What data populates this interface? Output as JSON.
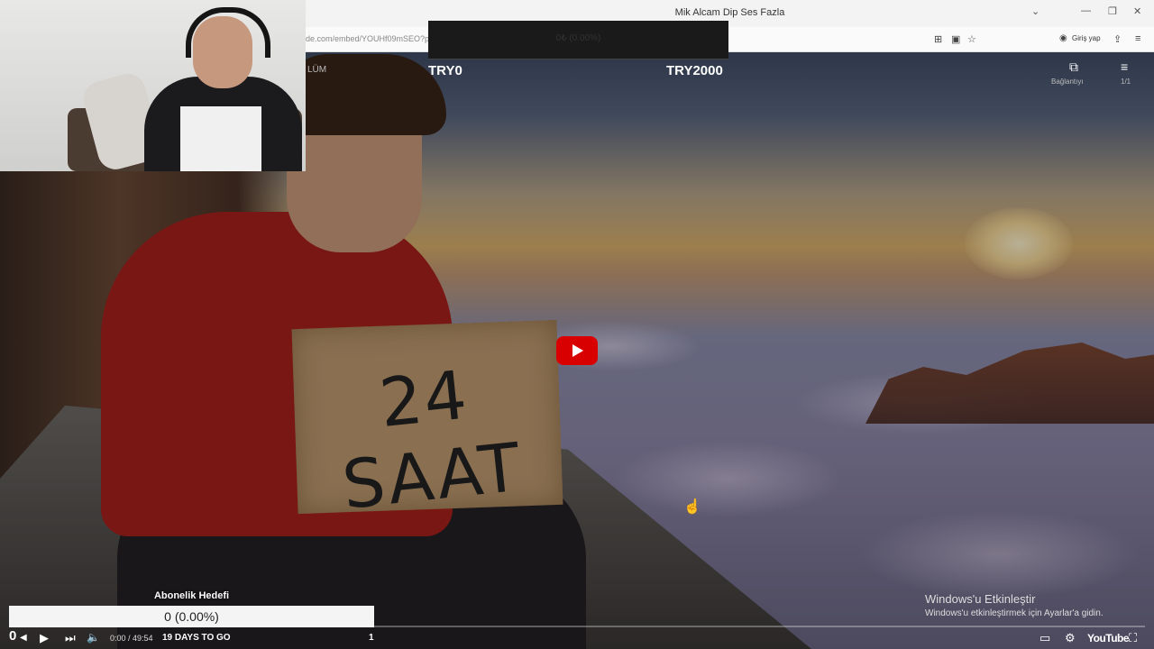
{
  "browser": {
    "window_title": "Mik Alcam Dip Ses Fazla",
    "url": "de.com/embed/YOUHf09mSEO?p",
    "login_label": "Giriş yap",
    "controls": {
      "minimize": "—",
      "maximize": "❐",
      "close": "✕",
      "dropdown": "⌄"
    }
  },
  "overlay": {
    "goal_value_top": "0₺ (0.00%)",
    "range_min": "TRY0",
    "range_max": "TRY2000",
    "chapter_text": "LÜM",
    "sub_goal_title": "Abonelik Hedefi",
    "sub_goal_value": "0 (0.00%)",
    "sub_goal_progress": 0
  },
  "top_right": {
    "copy_label": "Bağlantıyı",
    "playlist_label": "1/1"
  },
  "video": {
    "sign_text": "24 SAAT",
    "current_time": "0:00 / 49:54",
    "countdown": "19 DAYS TO GO",
    "counter": "1",
    "left_counter": "0",
    "brand": "YouTube"
  },
  "windows_activation": {
    "title": "Windows'u Etkinleştir",
    "subtitle": "Windows'u etkinleştirmek için Ayarlar'a gidin."
  },
  "icons": {
    "play": "▶",
    "next": "⏭",
    "volume": "🔈",
    "subtitles": "▭",
    "settings": "⚙",
    "fullscreen": "⛶",
    "copy": "⧉",
    "playlist": "≡",
    "cursor": "☝"
  }
}
